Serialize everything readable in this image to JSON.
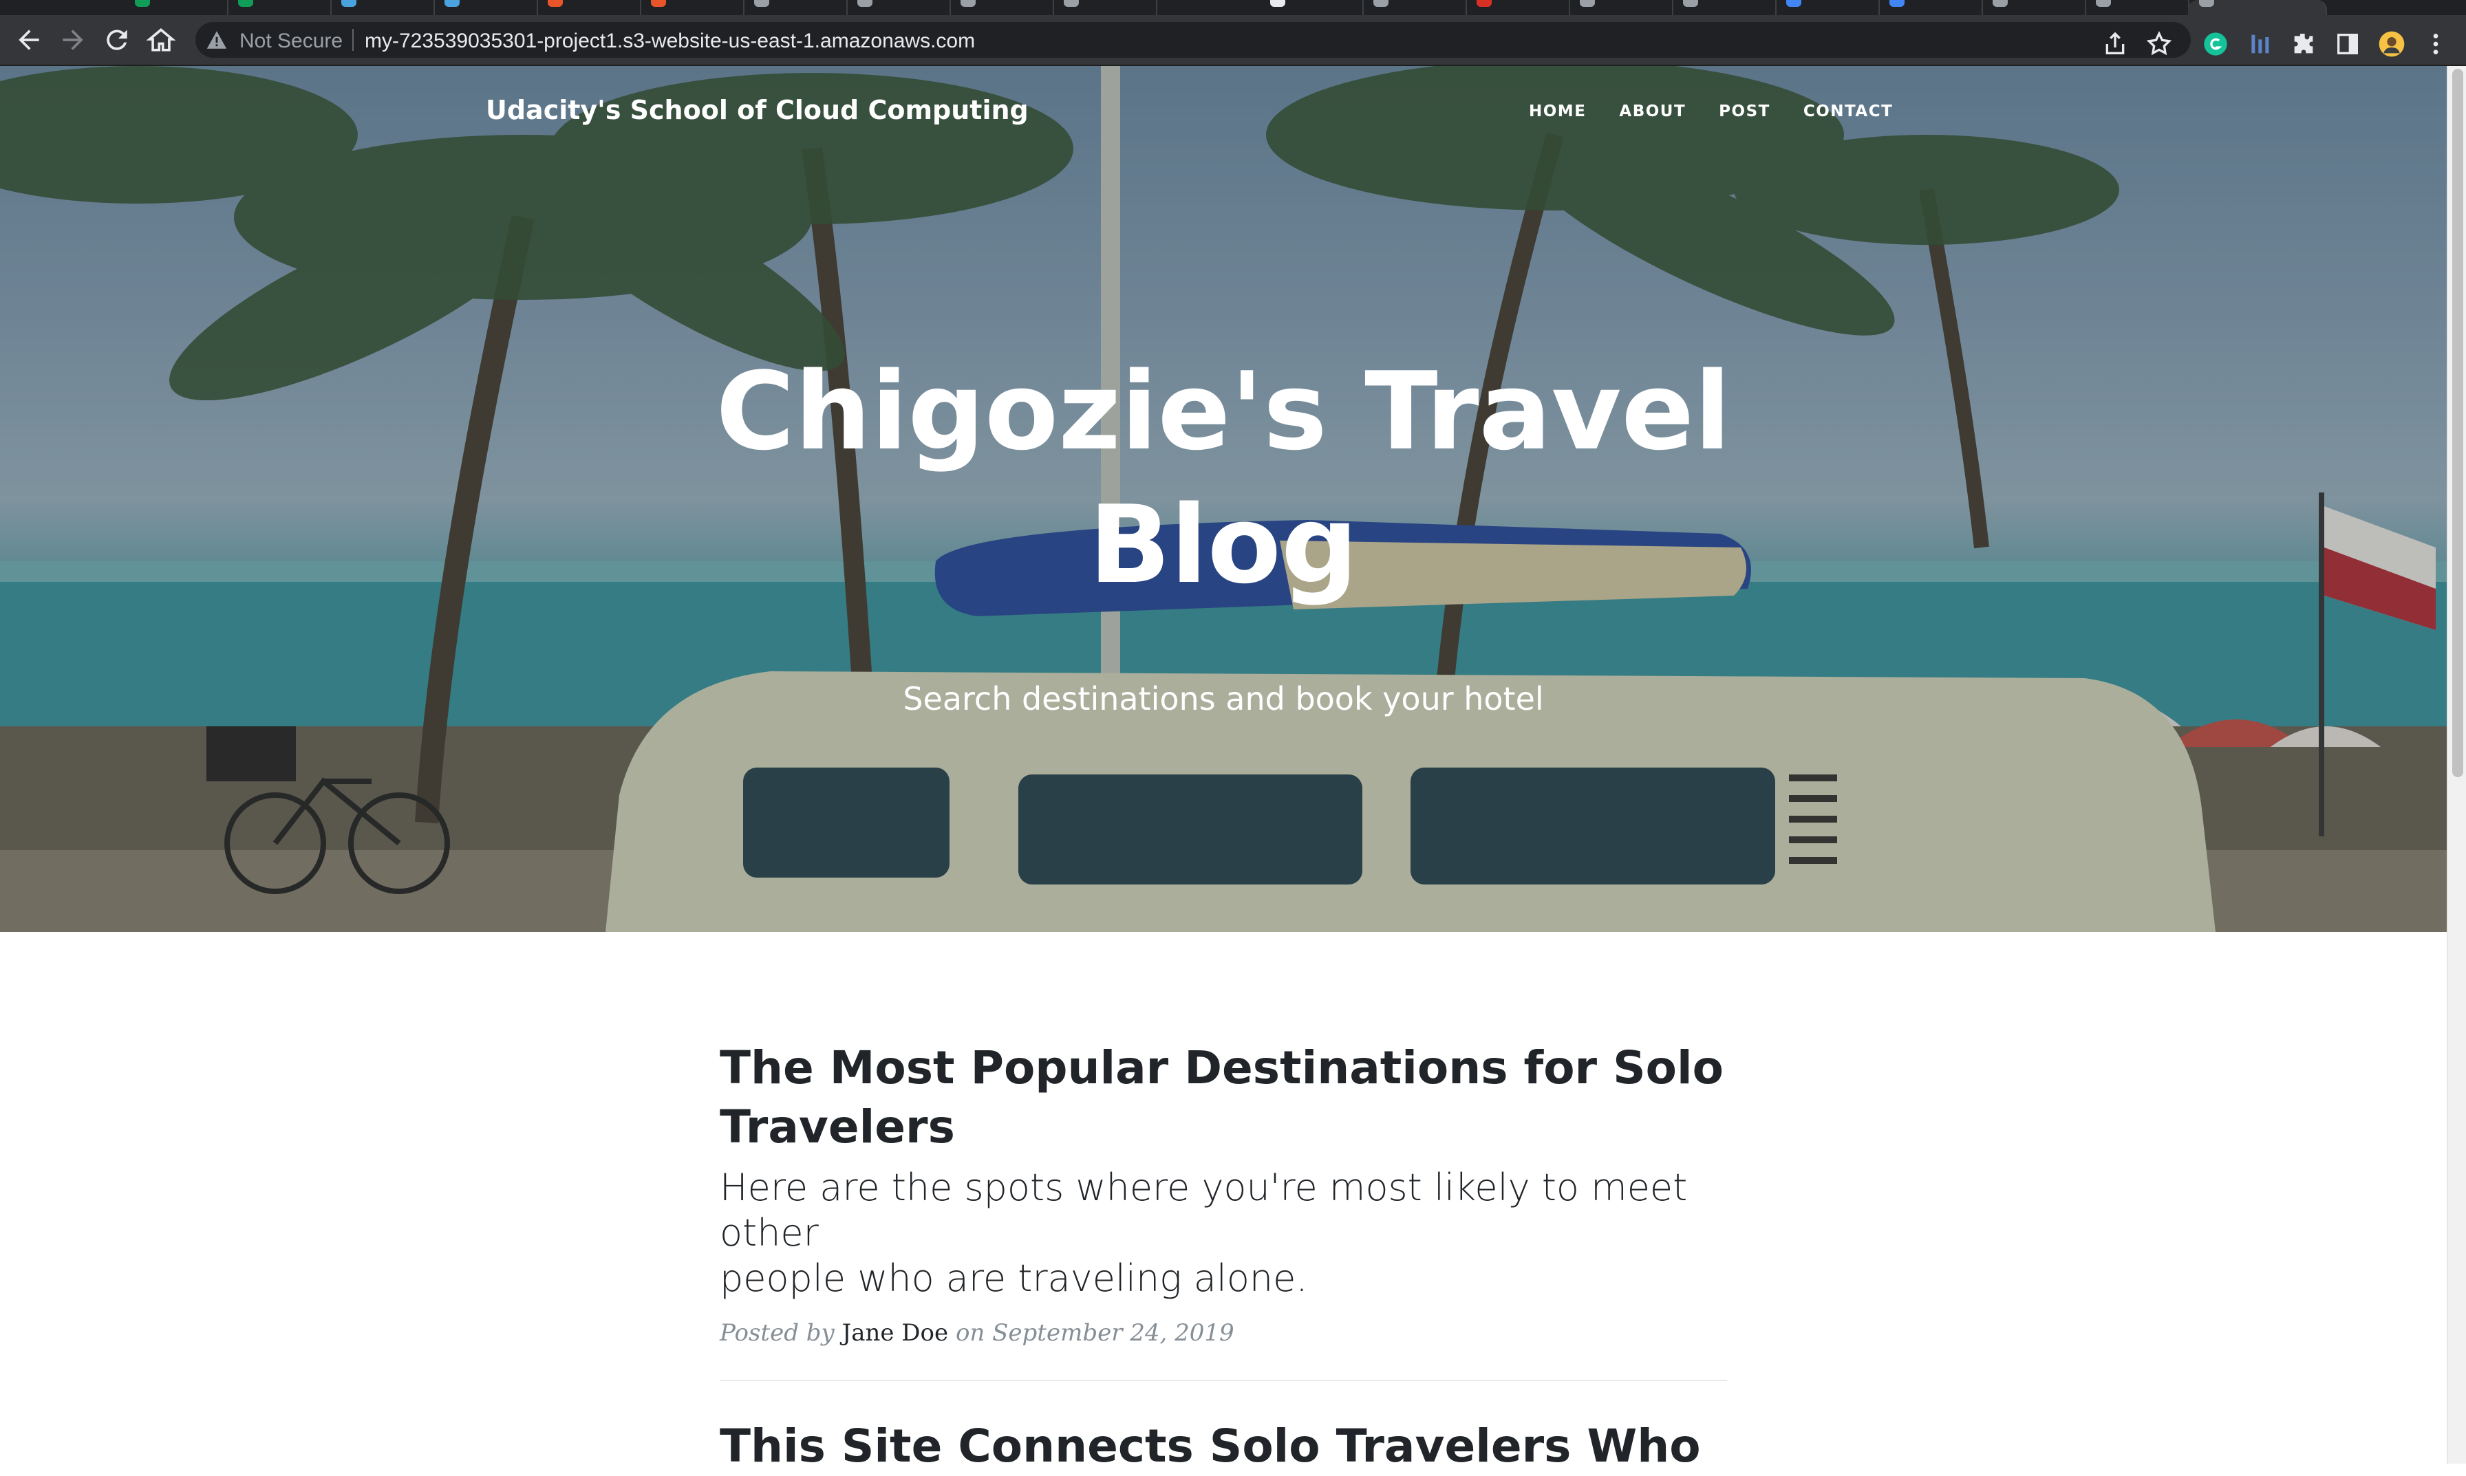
{
  "browser": {
    "security_label": "Not Secure",
    "url": "my-723539035301-project1.s3-website-us-east-1.amazonaws.com"
  },
  "site": {
    "brand": "Udacity's School of Cloud Computing",
    "nav": [
      "HOME",
      "ABOUT",
      "POST",
      "CONTACT"
    ]
  },
  "hero": {
    "title_line1": "Chigozie's Travel",
    "title_line2": "Blog",
    "subtitle": "Search destinations and book your hotel"
  },
  "posts": [
    {
      "title_line1": "The Most Popular Destinations for Solo",
      "title_line2": "Travelers",
      "subtitle_line1": "Here are the spots where you're most likely to meet other",
      "subtitle_line2": "people who are traveling alone.",
      "meta_prefix": "Posted by",
      "author": "Jane Doe",
      "meta_suffix": "on September 24, 2019"
    },
    {
      "title_line1": "This Site Connects Solo Travelers Who"
    }
  ],
  "colors": {
    "text": "#212529",
    "meta": "#868e96",
    "chrome": "#35363a"
  }
}
